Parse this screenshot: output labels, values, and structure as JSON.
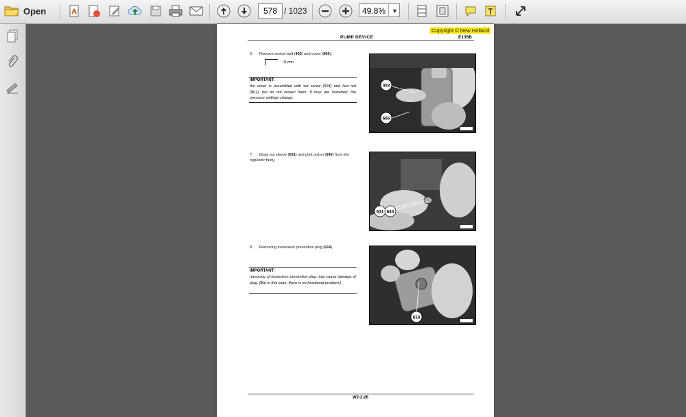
{
  "toolbar": {
    "open_label": "Open",
    "page_current": "578",
    "page_total": "/ 1023",
    "zoom": "49.8%"
  },
  "document": {
    "copyright": "Copyright © New Holland",
    "header_title": "PUMP DEVICE",
    "header_model": "E135B",
    "steps": [
      {
        "num": "6.",
        "text_parts": [
          "Remove socket bolt (",
          "402",
          ") and cover (",
          "866",
          ")."
        ]
      },
      {
        "num": "7.",
        "text_parts": [
          "Draw out sleeve (",
          "631",
          ") and pilot piston (",
          "643",
          ") from the regulator body."
        ]
      },
      {
        "num": "8.",
        "text_parts": [
          "Removing looseness prevention plug (",
          "616",
          ")."
        ]
      }
    ],
    "wrench_size": ": 5 mm",
    "important1_head": "IMPORTANT:",
    "important1_text": "the cover is assembled with set screw (924) and hex nut (801), but do not loosen them. If they are loosened, the pressure settings change.",
    "important2_head": "IMPORTANT:",
    "important2_text": "removing of looseness prevention plug may cause damage of plug. (But in this case, there is no functional problem.)",
    "photo1_callouts": [
      "402",
      "656"
    ],
    "photo2_callouts": [
      "631",
      "643"
    ],
    "photo3_callouts": [
      "616"
    ],
    "footer": "W2-2-26"
  }
}
